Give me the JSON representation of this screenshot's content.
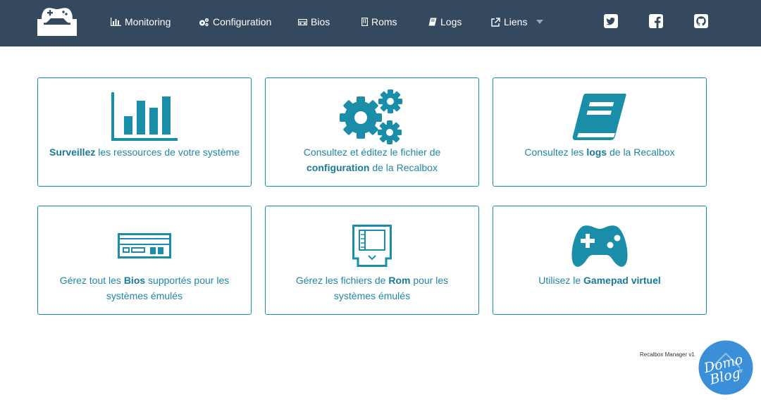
{
  "nav": {
    "items": [
      {
        "label": "Monitoring",
        "icon": "bar-chart-icon"
      },
      {
        "label": "Configuration",
        "icon": "gears-icon"
      },
      {
        "label": "Bios",
        "icon": "console-icon"
      },
      {
        "label": "Roms",
        "icon": "cartridge-icon"
      },
      {
        "label": "Logs",
        "icon": "book-icon"
      },
      {
        "label": "Liens",
        "icon": "external-link-icon"
      }
    ],
    "social": [
      "twitter-icon",
      "facebook-icon",
      "github-icon"
    ]
  },
  "cards": [
    {
      "bold": "Surveillez",
      "rest": " les ressources de votre système",
      "icon": "bar-chart-icon"
    },
    {
      "pre": "Consultez et éditez le fichier de ",
      "bold": "configuration",
      "post": " de la Recalbox",
      "icon": "gears-icon"
    },
    {
      "pre": "Consultez les ",
      "bold": "logs",
      "post": " de la Recalbox",
      "icon": "book-icon"
    },
    {
      "pre": "Gérez tout les ",
      "bold": "Bios",
      "post": " supportés pour les systèmes émulés",
      "icon": "console-icon"
    },
    {
      "pre": "Gérez les fichiers de ",
      "bold": "Rom",
      "post": " pour les systèmes émulés",
      "icon": "cartridge-icon"
    },
    {
      "pre": "Utilisez le ",
      "bold": "Gamepad virtuel",
      "post": "",
      "icon": "gamepad-icon"
    }
  ],
  "footer": {
    "version": "Recalbox Manager v1"
  },
  "watermark": {
    "line1": "Domo",
    "line2": "Blog",
    "suffix": "fr"
  },
  "colors": {
    "navbar": "#34495e",
    "accent": "#1a8ea8",
    "watermark": "#3a8fd8"
  }
}
